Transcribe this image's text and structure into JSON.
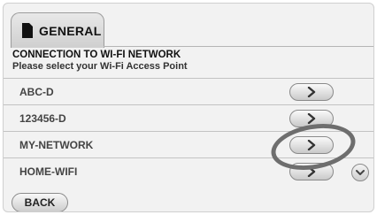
{
  "tab": {
    "label": "GENERAL",
    "icon": "document-icon"
  },
  "header": {
    "title": "CONNECTION TO WI-FI NETWORK",
    "subtitle": "Please select your Wi-Fi Access Point"
  },
  "networks": [
    {
      "name": "ABC-D"
    },
    {
      "name": "123456-D"
    },
    {
      "name": "MY-NETWORK"
    },
    {
      "name": "HOME-WIFI"
    }
  ],
  "highlighted_network": "MY-NETWORK",
  "footer": {
    "back_label": "BACK"
  },
  "colors": {
    "background": "#f2f2f2",
    "highlight_ring": "#6e6e6e",
    "button_border": "#8a8a8a"
  }
}
